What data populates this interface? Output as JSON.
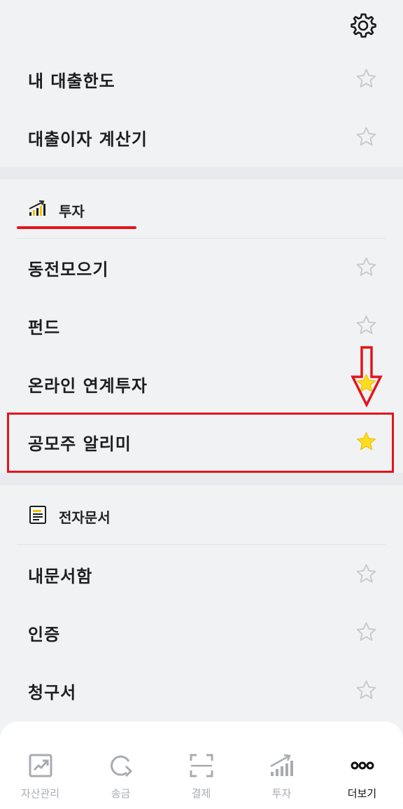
{
  "header": {
    "settings_icon": "gear-icon"
  },
  "top_menu": [
    {
      "label": "내 대출한도",
      "favorite": false
    },
    {
      "label": "대출이자 계산기",
      "favorite": false
    }
  ],
  "invest_section": {
    "title": "투자",
    "icon": "bar-chart-icon",
    "items": [
      {
        "label": "동전모으기",
        "favorite": false
      },
      {
        "label": "펀드",
        "favorite": false
      },
      {
        "label": "온라인 연계투자",
        "favorite": true
      },
      {
        "label": "공모주 알리미",
        "favorite": true
      }
    ]
  },
  "doc_section": {
    "title": "전자문서",
    "icon": "document-icon",
    "items": [
      {
        "label": "내문서함",
        "favorite": false
      },
      {
        "label": "인증",
        "favorite": false
      },
      {
        "label": "청구서",
        "favorite": false
      }
    ]
  },
  "tabbar": {
    "items": [
      {
        "label": "자산관리",
        "icon": "asset-chart-icon",
        "active": false
      },
      {
        "label": "송금",
        "icon": "transfer-icon",
        "active": false
      },
      {
        "label": "결제",
        "icon": "scan-icon",
        "active": false
      },
      {
        "label": "투자",
        "icon": "bar-chart-icon",
        "active": false
      },
      {
        "label": "더보기",
        "icon": "more-dots-icon",
        "active": true
      }
    ]
  },
  "colors": {
    "accent_red": "#e4141b",
    "star_yellow": "#ffdb21",
    "star_outline": "#c8cacf"
  }
}
